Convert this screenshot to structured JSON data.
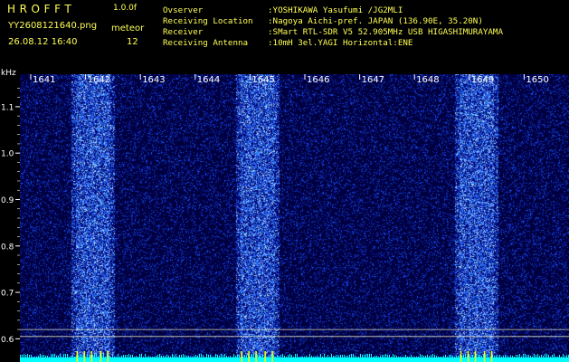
{
  "header": {
    "app_title": "HROFFT",
    "app_version": "1.0.0f",
    "file_name": "YY2608121640.png",
    "datetime": "26.08.12 16:40",
    "meteor_label": "meteor",
    "meteor_count": "12"
  },
  "station_info": [
    {
      "label": "Ovserver",
      "value": ":YOSHIKAWA Yasufumi /JG2MLI"
    },
    {
      "label": "Receiving Location",
      "value": ":Nagoya Aichi-pref. JAPAN (136.90E, 35.20N)"
    },
    {
      "label": "Receiver",
      "value": ":SMart RTL-SDR V5 52.905MHz USB HIGASHIMURAYAMA"
    },
    {
      "label": "Receiving Antenna",
      "value": ":10mH 3el.YAGI Horizontal:ENE"
    }
  ],
  "spectrogram": {
    "y_axis_unit": "kHz",
    "y_ticks": [
      "1.1",
      "1.0",
      "0.9",
      "0.8",
      "0.7",
      "0.6"
    ],
    "y_tick_values": [
      1.1,
      1.0,
      0.9,
      0.8,
      0.7,
      0.6
    ],
    "y_range": [
      0.55,
      1.17
    ],
    "time_labels": [
      "1641",
      "1642",
      "1643",
      "1644",
      "1645",
      "1646",
      "1647",
      "1648",
      "1649",
      "1650"
    ],
    "bright_minutes": [
      "1642",
      "1645",
      "1649"
    ],
    "reference_lines_khz": [
      0.62,
      0.605
    ],
    "colors": {
      "background": "#000000",
      "noise_base": "#00003a",
      "noise_speck": "#2a3cff",
      "bright_speck": "#8cc8ff",
      "baseline": "#00ffff",
      "markers": "#ffff00",
      "axis_text": "#ffffff",
      "header_text": "#ffff55",
      "reference_line": "#ffffcc"
    }
  }
}
